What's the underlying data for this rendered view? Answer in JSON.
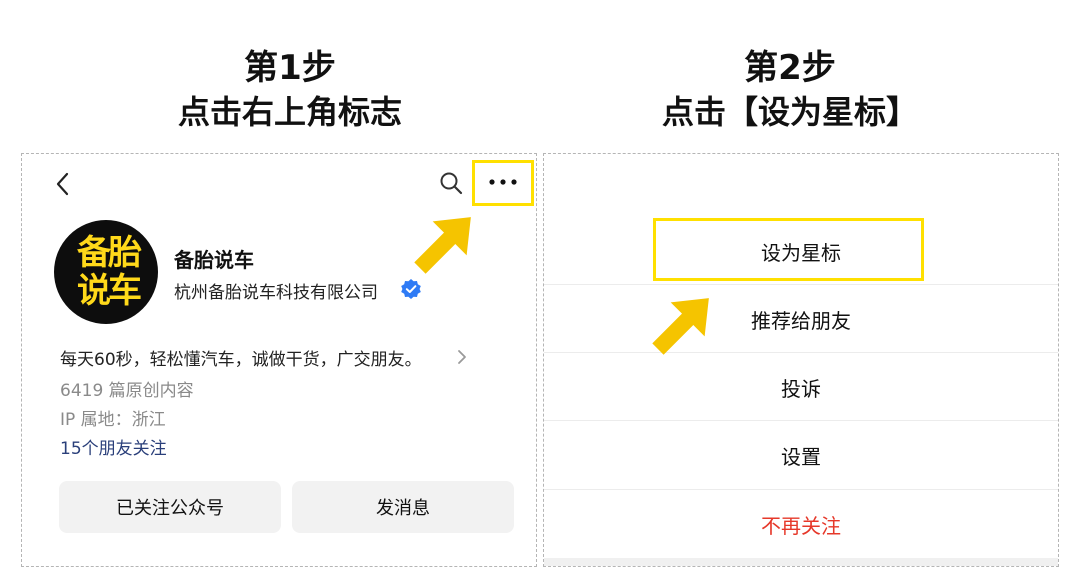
{
  "steps": [
    {
      "number": "第1步",
      "instruction": "点击右上角标志"
    },
    {
      "number": "第2步",
      "instruction": "点击【设为星标】"
    }
  ],
  "profile": {
    "avatar_text_line1": "备胎",
    "avatar_text_line2": "说车",
    "name": "备胎说车",
    "company": "杭州备胎说车科技有限公司",
    "description": "每天60秒，轻松懂汽车，诚做干货，广交朋友。",
    "article_count": "6419 篇原创内容",
    "ip_location": "IP 属地：浙江",
    "friends_following": "15个朋友关注",
    "buttons": {
      "followed": "已关注公众号",
      "message": "发消息"
    }
  },
  "menu": {
    "items": [
      "设为星标",
      "推荐给朋友",
      "投诉",
      "设置",
      "不再关注"
    ]
  },
  "icons": {
    "back": "chevron-left-icon",
    "search": "search-icon",
    "more": "more-dots-icon",
    "verified": "verified-badge-icon",
    "arrow": "pointer-arrow-icon"
  },
  "colors": {
    "highlight": "#ffe000",
    "arrow": "#f5c400",
    "avatar_text": "#ffd91a",
    "verified": "#2f7bf5",
    "link": "#2a3f7a",
    "danger": "#e6382a"
  }
}
